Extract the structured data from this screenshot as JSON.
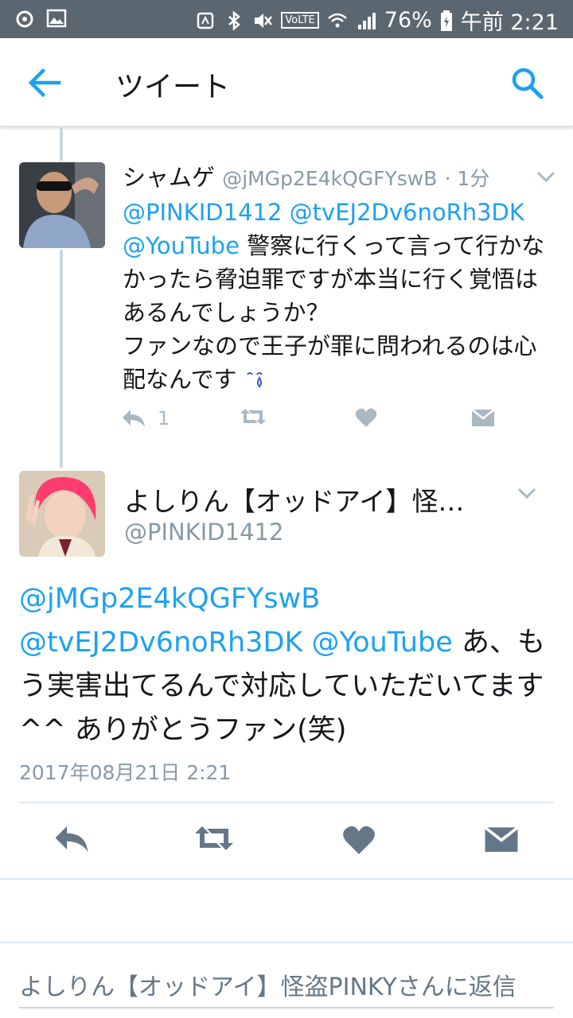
{
  "status_bar": {
    "battery": "76%",
    "time": "午前 2:21",
    "volte": "VoLTE"
  },
  "header": {
    "title": "ツイート"
  },
  "tweet_parent": {
    "name": "シャムゲ",
    "handle": "@jMGp2E4kQGFYswB",
    "time": "· 1分",
    "mentions": [
      "@PINKID1412",
      "@tvEJ2Dv6noRh3DK",
      "@YouTube"
    ],
    "text_after_mentions": "警察に行くって言って行かなかったら脅迫罪ですが本当に行く覚悟はあるんでしょうか？",
    "text_line2": "ファンなので王子が罪に問われるのは心配なんです",
    "reply_count": "1"
  },
  "tweet_main": {
    "name": "よしりん【オッドアイ】怪…",
    "handle": "@PINKID1412",
    "mentions": [
      "@jMGp2E4kQGFYswB",
      "@tvEJ2Dv6noRh3DK",
      "@YouTube"
    ],
    "text": "あ、もう実害出てるんで対応していただいてます^^ ありがとうファン(笑)",
    "date": "2017年08月21日 2:21"
  },
  "reply_prompt": "よしりん【オッドアイ】怪盗PINKYさんに返信",
  "colors": {
    "accent": "#1da1f2",
    "status_bar": "#5b6770",
    "icon_gray": "#aab8c2",
    "icon_dark": "#657786"
  }
}
